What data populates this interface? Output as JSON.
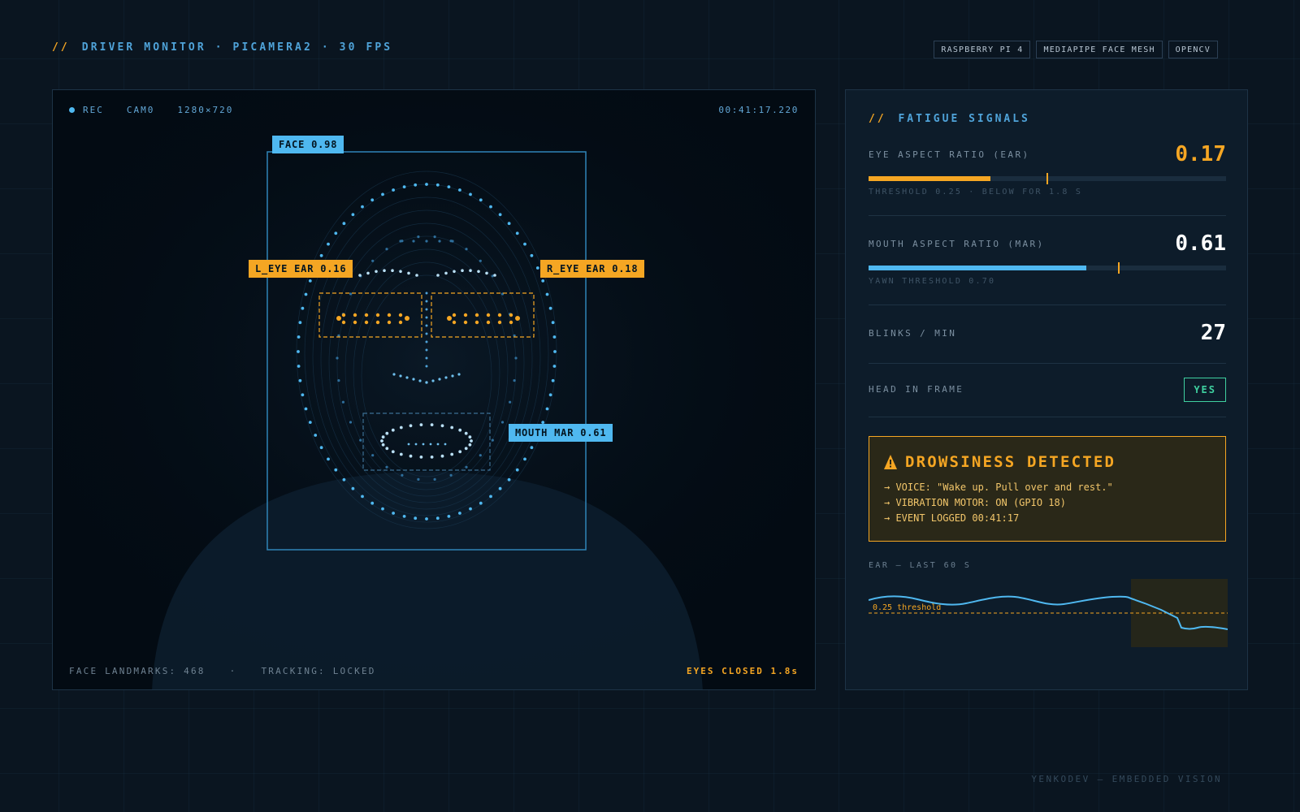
{
  "header": {
    "slashes": "//",
    "title": "DRIVER MONITOR · PICAMERA2 · 30 FPS",
    "badges": [
      "RASPBERRY PI 4",
      "MEDIAPIPE FACE MESH",
      "OPENCV"
    ]
  },
  "camera": {
    "rec_label": "REC",
    "camera_id": "CAM0",
    "resolution": "1280×720",
    "timecode": "00:41:17.220",
    "face_tag": "FACE 0.98",
    "left_eye_tag": "L_EYE EAR 0.16",
    "right_eye_tag": "R_EYE EAR 0.18",
    "mouth_tag": "MOUTH MAR 0.61",
    "landmarks_status": "FACE LANDMARKS: 468",
    "separator": "·",
    "tracking_status": "TRACKING: LOCKED",
    "eyes_closed_status": "EYES CLOSED 1.8s"
  },
  "signals": {
    "slashes": "//",
    "title": "FATIGUE SIGNALS",
    "ear": {
      "label": "EYE ASPECT RATIO (EAR)",
      "value": "0.17",
      "level": 0.34,
      "threshold_position": 0.5,
      "sub": "THRESHOLD 0.25 · BELOW FOR 1.8 S"
    },
    "mar": {
      "label": "MOUTH ASPECT RATIO (MAR)",
      "value": "0.61",
      "level": 0.61,
      "threshold_position": 0.7,
      "sub": "YAWN THRESHOLD 0.70"
    },
    "blinks": {
      "label": "BLINKS / MIN",
      "value": "27"
    },
    "head": {
      "label": "HEAD IN FRAME",
      "value": "YES"
    }
  },
  "alert": {
    "icon": "warning-icon",
    "title": "DROWSINESS DETECTED",
    "lines": [
      "→ VOICE: \"Wake up. Pull over and rest.\"",
      "→ VIBRATION MOTOR: ON (GPIO 18)",
      "→ EVENT LOGGED 00:41:17"
    ]
  },
  "ear_history": {
    "label": "EAR — LAST 60 S",
    "threshold_label": "0.25 threshold",
    "threshold": 0.25
  },
  "footer": "YENKODEV — EMBEDDED VISION",
  "colors": {
    "accent_blue": "#4fb8f0",
    "accent_orange": "#f5a623",
    "ok_green": "#3fd0a0",
    "background": "#0a1520"
  }
}
